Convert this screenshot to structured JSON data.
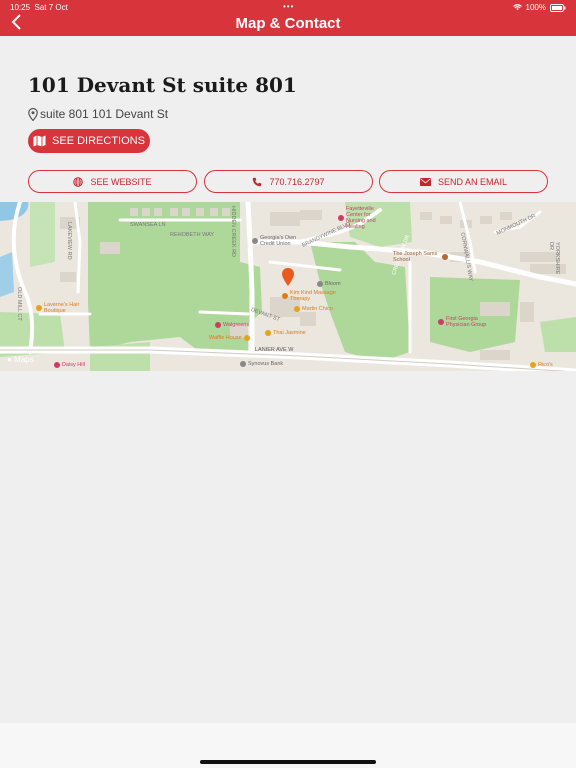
{
  "status_bar": {
    "time": "10:25",
    "date": "Sat 7 Oct",
    "battery": "100%",
    "dots": "•••"
  },
  "header": {
    "title": "Map & Contact",
    "back_icon": "chevron-left-icon"
  },
  "location": {
    "title": "101 Devant St suite 801",
    "address": "suite 801 101 Devant St"
  },
  "actions": {
    "directions": "SEE DIRECTIONS",
    "website": "SEE WEBSITE",
    "phone": "770.716.2797",
    "email": "SEND AN EMAIL"
  },
  "map": {
    "attribution": "Maps",
    "streets": [
      "SWANSEA LN",
      "REHOBETH WAY",
      "HIDDEN CREEK RD",
      "BRANDYWINE BLVD",
      "LAKEVIEW RD",
      "DEVANT ST",
      "LANIER AVE W",
      "CRESTVIEW DR",
      "OLD MILL CT",
      "CORNWALLIS WAY",
      "MONMOUTH DR",
      "YORKSHIRE DR"
    ],
    "places": [
      "Fayetteville Center for Nursing and Healing",
      "Georgia's Own Credit Union",
      "The Joseph Sams School",
      "Bloom",
      "Kim Kind Massage Therapy",
      "Martin Chico",
      "Laverne's Hair Boutique",
      "Walgreens",
      "Thai Jasmine",
      "Waffle House",
      "Synovus Bank",
      "First Georgia Physician Group",
      "Daisy Hill",
      "Rico's"
    ]
  },
  "colors": {
    "accent": "#d7343b"
  }
}
